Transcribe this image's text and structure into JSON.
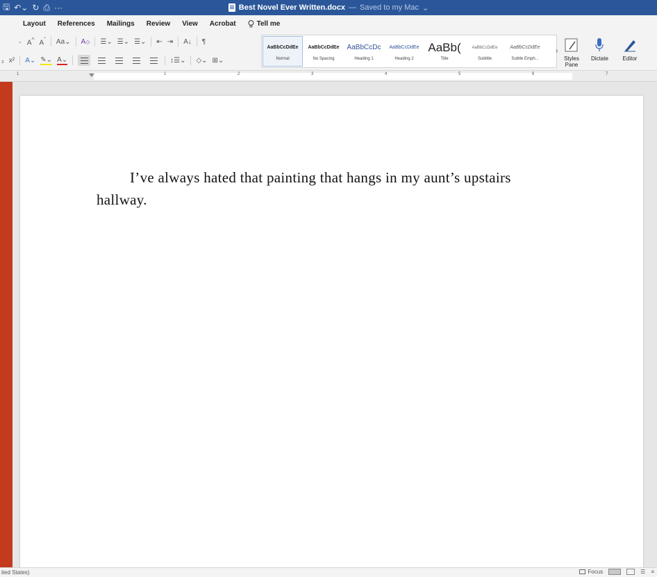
{
  "window": {
    "title": "Best Novel Ever Written.docx",
    "separator": "—",
    "save_status": "Saved to my Mac",
    "save_status_caret": "⌄"
  },
  "menu": {
    "tabs": [
      "Layout",
      "References",
      "Mailings",
      "Review",
      "View",
      "Acrobat"
    ],
    "tell_me": "Tell me"
  },
  "ribbon": {
    "styles": [
      {
        "preview": "AaBbCcDdEe",
        "name": "Normal"
      },
      {
        "preview": "AaBbCcDdEe",
        "name": "No Spacing"
      },
      {
        "preview": "AaBbCcDc",
        "name": "Heading 1"
      },
      {
        "preview": "AaBbCcDdEe",
        "name": "Heading 2"
      },
      {
        "preview": "AaBb(",
        "name": "Title"
      },
      {
        "preview": "AaBbCcDdEe",
        "name": "Subtitle"
      },
      {
        "preview": "AaBbCcDdEe",
        "name": "Subtle Emph..."
      }
    ],
    "styles_pane": "Styles Pane",
    "dictate": "Dictate",
    "editor": "Editor"
  },
  "ruler": {
    "numbers": [
      "1",
      "1",
      "2",
      "3",
      "4",
      "5",
      "6",
      "7"
    ]
  },
  "document": {
    "paragraph": "I’ve always hated that painting that hangs in my aunt’s upstairs hallway."
  },
  "status": {
    "language": "ited States)",
    "focus": "Focus"
  }
}
